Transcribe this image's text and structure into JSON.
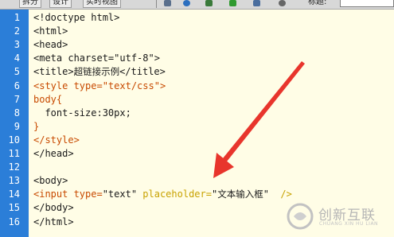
{
  "toolbar": {
    "tab_code": "拆分",
    "tab_design": "设计",
    "tab_live": "实时视图",
    "title_label": "标题:"
  },
  "editor": {
    "lines": [
      {
        "num": "1",
        "segments": [
          {
            "t": "<!doctype html>",
            "c": "plain"
          }
        ]
      },
      {
        "num": "2",
        "segments": [
          {
            "t": "<html>",
            "c": "plain"
          }
        ]
      },
      {
        "num": "3",
        "segments": [
          {
            "t": "<head>",
            "c": "plain"
          }
        ]
      },
      {
        "num": "4",
        "segments": [
          {
            "t": "<meta charset=\"utf-8\">",
            "c": "plain"
          }
        ]
      },
      {
        "num": "5",
        "segments": [
          {
            "t": "<title>",
            "c": "plain"
          },
          {
            "t": "超链接示例",
            "c": "zh"
          },
          {
            "t": "</title>",
            "c": "plain"
          }
        ]
      },
      {
        "num": "6",
        "segments": [
          {
            "t": "<style type=\"text/css\">",
            "c": "kw"
          }
        ]
      },
      {
        "num": "7",
        "segments": [
          {
            "t": "body{",
            "c": "kw"
          }
        ]
      },
      {
        "num": "8",
        "segments": [
          {
            "t": "  font-size:30px;",
            "c": "plain"
          }
        ]
      },
      {
        "num": "9",
        "segments": [
          {
            "t": "}",
            "c": "kw"
          }
        ]
      },
      {
        "num": "10",
        "segments": [
          {
            "t": "</style>",
            "c": "kw"
          }
        ]
      },
      {
        "num": "11",
        "segments": [
          {
            "t": "</head>",
            "c": "plain"
          }
        ]
      },
      {
        "num": "12",
        "segments": [
          {
            "t": "",
            "c": "plain"
          }
        ]
      },
      {
        "num": "13",
        "segments": [
          {
            "t": "<body>",
            "c": "plain"
          }
        ]
      },
      {
        "num": "14",
        "segments": [
          {
            "t": "<input type=",
            "c": "kw"
          },
          {
            "t": "\"text\"",
            "c": "plain"
          },
          {
            "t": " placeholder=",
            "c": "at"
          },
          {
            "t": "\"",
            "c": "plain"
          },
          {
            "t": "文本输入框",
            "c": "zh"
          },
          {
            "t": "\"",
            "c": "plain"
          },
          {
            "t": "  />",
            "c": "at"
          }
        ]
      },
      {
        "num": "15",
        "segments": [
          {
            "t": "</body>",
            "c": "plain"
          }
        ]
      },
      {
        "num": "16",
        "segments": [
          {
            "t": "</html>",
            "c": "plain"
          }
        ]
      }
    ]
  },
  "watermark": {
    "name": "创新互联",
    "sub": "CHUANG XIN HU LIAN"
  },
  "colors": {
    "gutter": "#2b7ed8",
    "editor_bg": "#fffde6",
    "arrow": "#e8352c",
    "keyword": "#c84a00",
    "attribute": "#c8a200"
  }
}
